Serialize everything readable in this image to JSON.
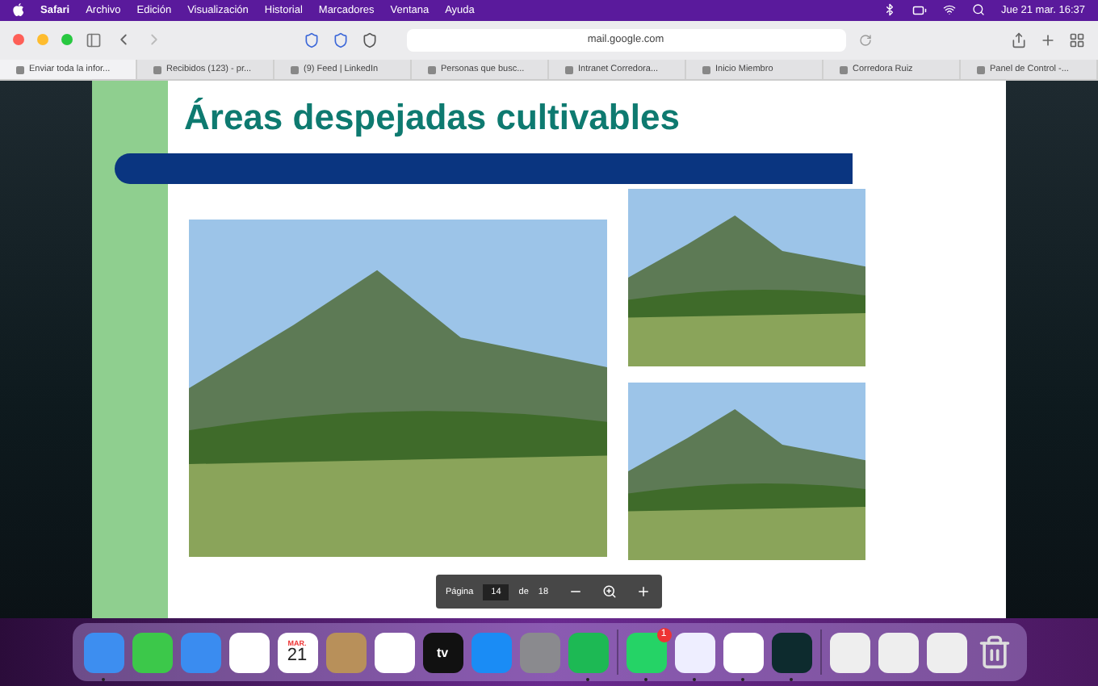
{
  "menu_bar": {
    "app": "Safari",
    "menus": [
      "Archivo",
      "Edición",
      "Visualización",
      "Historial",
      "Marcadores",
      "Ventana",
      "Ayuda"
    ],
    "clock": "Jue 21 mar. 16:37"
  },
  "toolbar": {
    "address": "mail.google.com"
  },
  "tabs": [
    {
      "label": "Enviar toda la infor...",
      "selected": true
    },
    {
      "label": "Recibidos (123) - pr...",
      "selected": false
    },
    {
      "label": "(9) Feed | LinkedIn",
      "selected": false
    },
    {
      "label": "Personas que busc...",
      "selected": false
    },
    {
      "label": "Intranet Corredora...",
      "selected": false
    },
    {
      "label": "Inicio Miembro",
      "selected": false
    },
    {
      "label": "Corredora Ruiz",
      "selected": false
    },
    {
      "label": "Panel de Control -...",
      "selected": false
    }
  ],
  "slide": {
    "title": "Áreas despejadas cultivables",
    "page_control": {
      "label": "Página",
      "page": "14",
      "of": "de",
      "total": "18"
    }
  },
  "dock": [
    {
      "kind": "finder",
      "running": true
    },
    {
      "kind": "messages",
      "running": false
    },
    {
      "kind": "mail",
      "running": false
    },
    {
      "kind": "photos",
      "running": false
    },
    {
      "kind": "calendar",
      "month": "MAR.",
      "day": "21",
      "running": false
    },
    {
      "kind": "contacts",
      "running": false
    },
    {
      "kind": "reminders",
      "running": false
    },
    {
      "kind": "tv",
      "label": "tv",
      "running": false
    },
    {
      "kind": "appstore",
      "running": false
    },
    {
      "kind": "settings",
      "running": false
    },
    {
      "kind": "spotify",
      "running": true
    },
    {
      "kind": "divider"
    },
    {
      "kind": "whatsapp",
      "badge": "1",
      "running": true
    },
    {
      "kind": "safari",
      "running": true
    },
    {
      "kind": "chrome",
      "running": true
    },
    {
      "kind": "audio",
      "running": true
    },
    {
      "kind": "divider"
    },
    {
      "kind": "window",
      "running": false
    },
    {
      "kind": "window",
      "running": false
    },
    {
      "kind": "window",
      "running": false
    },
    {
      "kind": "trash",
      "running": false
    }
  ]
}
